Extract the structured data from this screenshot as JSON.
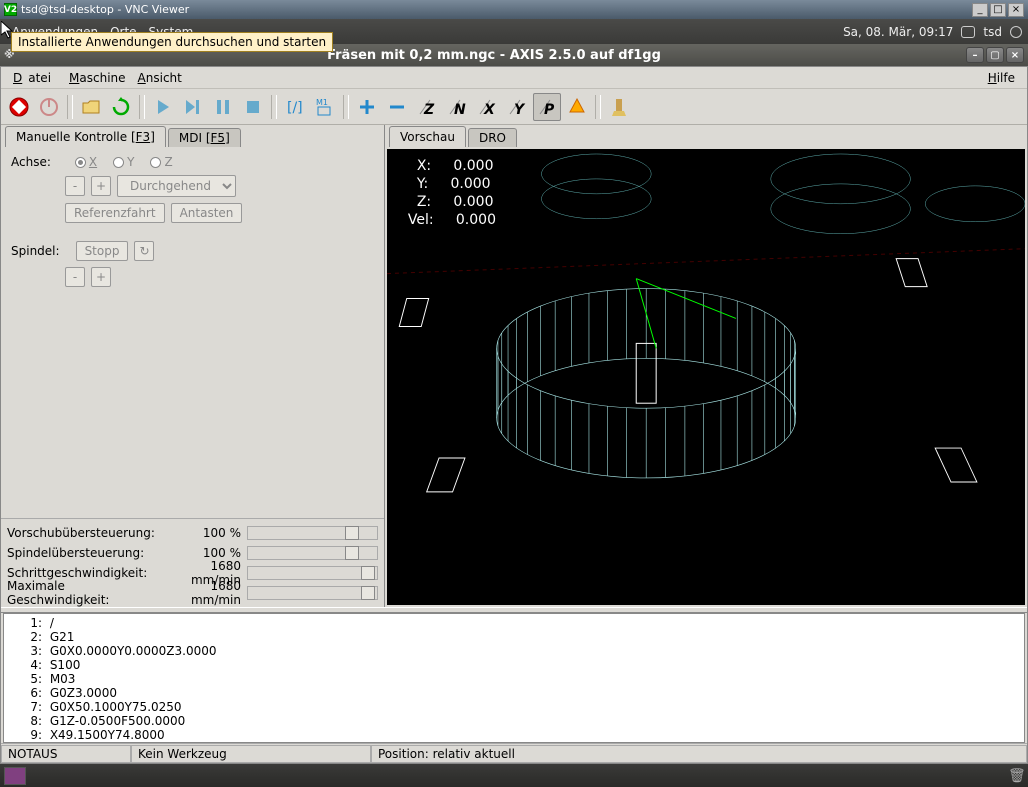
{
  "vnc": {
    "title": "tsd@tsd-desktop - VNC Viewer",
    "icon": "V2"
  },
  "gnome": {
    "menu1": "Anwendungen",
    "menu2": "Orte",
    "menu3": "System",
    "datetime": "Sa, 08. Mär, 09:17",
    "user": "tsd"
  },
  "tooltip": "Installierte Anwendungen durchsuchen und starten",
  "xwin": {
    "title": "Fräsen mit 0,2 mm.ngc - AXIS 2.5.0 auf  df1gg"
  },
  "menubar": {
    "file": "Datei",
    "machine": "Maschine",
    "view": "Ansicht",
    "help": "Hilfe"
  },
  "left_tabs": {
    "t1": "Manuelle Kontrolle [F3]",
    "t2": "MDI [F5]"
  },
  "right_tabs": {
    "t1": "Vorschau",
    "t2": "DRO"
  },
  "controls": {
    "axis_label": "Achse:",
    "axis_x": "X",
    "axis_y": "Y",
    "axis_z": "Z",
    "cont": "Durchgehend",
    "refhome": "Referenzfahrt",
    "probe": "Antasten",
    "spindle_label": "Spindel:",
    "stop": "Stopp"
  },
  "overrides": {
    "r1l": "Vorschubübersteuerung:",
    "r1v": "100 %",
    "r2l": "Spindelübersteuerung:",
    "r2v": "100 %",
    "r3l": "Schrittgeschwindigkeit:",
    "r3v": "1680 mm/min",
    "r4l": "Maximale Geschwindigkeit:",
    "r4v": "1680 mm/min"
  },
  "dro": {
    "x_label": "X:",
    "x": "0.000",
    "y_label": "Y:",
    "y": "0.000",
    "z_label": "Z:",
    "z": "0.000",
    "vel_label": "Vel:",
    "vel": "0.000"
  },
  "gcode": [
    {
      "n": "1",
      "t": "/"
    },
    {
      "n": "2",
      "t": "G21"
    },
    {
      "n": "3",
      "t": "G0X0.0000Y0.0000Z3.0000"
    },
    {
      "n": "4",
      "t": "S100"
    },
    {
      "n": "5",
      "t": "M03"
    },
    {
      "n": "6",
      "t": "G0Z3.0000"
    },
    {
      "n": "7",
      "t": "G0X50.1000Y75.0250"
    },
    {
      "n": "8",
      "t": "G1Z-0.0500F500.0000"
    },
    {
      "n": "9",
      "t": "X49.1500Y74.8000"
    }
  ],
  "status": {
    "s1": "NOTAUS",
    "s2": "Kein Werkzeug",
    "s3": "Position: relativ aktuell"
  },
  "toolbar_letters": {
    "z": "Z",
    "n": "N",
    "x": "X",
    "y": "Y",
    "p": "P"
  }
}
